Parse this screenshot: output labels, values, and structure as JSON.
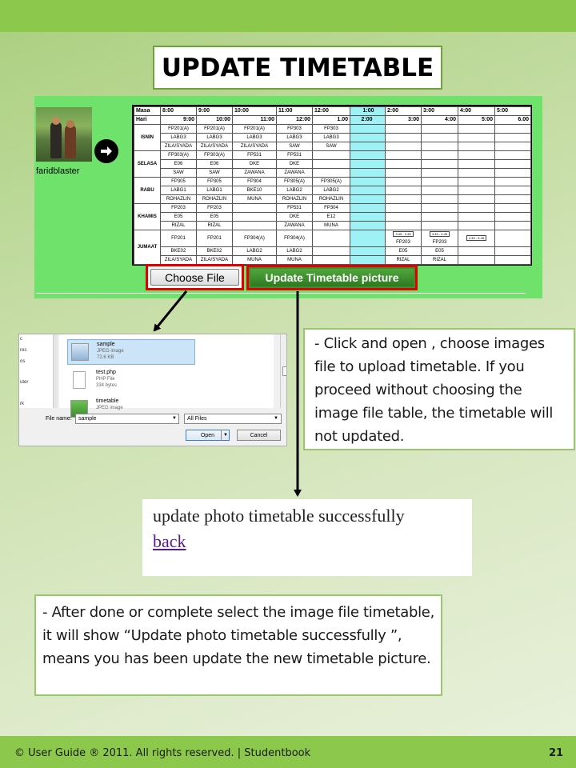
{
  "page": {
    "title": "UPDATE TIMETABLE",
    "footer": "© User Guide ® 2011. All rights reserved. | Studentbook",
    "page_number": "21"
  },
  "profile": {
    "username": "faridblaster",
    "avatar_icon": "profile-photo",
    "arrow_icon": "right-arrow-circle-icon"
  },
  "timetable": {
    "header_masa": "Masa",
    "header_hari": "Hari",
    "slots_start": [
      "8:00",
      "9:00",
      "10:00",
      "11:00",
      "12:00",
      "1:00",
      "2:00",
      "3:00",
      "4:00",
      "5:00"
    ],
    "slots_end": [
      "9:00",
      "10:00",
      "11:00",
      "12:00",
      "1.00",
      "2:00",
      "3:00",
      "4:00",
      "5:00",
      "6.00"
    ],
    "days": [
      {
        "name": "ISNIN",
        "cells": [
          [
            "FP201(A)",
            "LABG3",
            "ZILA/SYADA"
          ],
          [
            "FP201(A)",
            "LABG3",
            "ZILA/SYADA"
          ],
          [
            "FP201(A)",
            "LABG3",
            "ZILA/SYADA"
          ],
          [
            "FP303",
            "LABG3",
            "SAW"
          ],
          [
            "FP303",
            "LABG3",
            "SAW"
          ]
        ]
      },
      {
        "name": "SELASA",
        "cells": [
          [
            "FP303(A)",
            "E06",
            "SAW"
          ],
          [
            "FP303(A)",
            "E06",
            "SAW"
          ],
          [
            "FP531",
            "DKE",
            "ZAWANA"
          ],
          [
            "FP531",
            "DKE",
            "ZAWANA"
          ],
          [
            "",
            "",
            ""
          ]
        ]
      },
      {
        "name": "RABU",
        "cells": [
          [
            "FP305",
            "LABG1",
            "ROHAZLIN"
          ],
          [
            "FP305",
            "LABG1",
            "ROHAZLIN"
          ],
          [
            "FP304",
            "BKE10",
            "MUNA"
          ],
          [
            "FP305(A)",
            "LABG2",
            "ROHAZLIN"
          ],
          [
            "FP305(A)",
            "LABG2",
            "ROHAZLIN"
          ]
        ]
      },
      {
        "name": "KHAMIS",
        "cells": [
          [
            "FP203",
            "E05",
            "RIZAL"
          ],
          [
            "FP203",
            "E05",
            "RIZAL"
          ],
          [
            "",
            "",
            ""
          ],
          [
            "FP531",
            "DKE",
            "ZAWANA"
          ],
          [
            "FP304",
            "E12",
            "MUNA"
          ]
        ]
      },
      {
        "name": "JUMAAT",
        "cells": [
          [
            "FP201",
            "BKE02",
            "ZILA/SYADA"
          ],
          [
            "FP201",
            "BKE02",
            "ZILA/SYADA"
          ],
          [
            "FP304(A)",
            "LABG2",
            "MUNA"
          ],
          [
            "FP304(A)",
            "LABG2",
            "MUNA"
          ],
          [
            "",
            "",
            ""
          ]
        ],
        "afternoon": [
          [
            "3.45 - 3.45",
            "FP203",
            "E05",
            "RIZAL"
          ],
          [
            "3.45 - 4.45",
            "FP203",
            "E05",
            "RIZAL"
          ],
          [
            "4.45 - 5.45",
            "",
            "",
            ""
          ]
        ]
      }
    ]
  },
  "buttons": {
    "choose_file": "Choose File",
    "update_picture": "Update Timetable picture"
  },
  "file_dialog": {
    "sidebar_fragments": [
      "c",
      "res",
      "os",
      "uter",
      "rk"
    ],
    "files": [
      {
        "name": "sample",
        "type": "JPEG image",
        "size": "72.6 KB"
      },
      {
        "name": "test.php",
        "type": "PHP File",
        "size": "334 bytes"
      },
      {
        "name": "timetable",
        "type": "JPEG image",
        "size": ""
      }
    ],
    "file_name_label": "File name:",
    "file_name_value": "sample",
    "file_type_value": "All Files",
    "open_label": "Open",
    "cancel_label": "Cancel"
  },
  "notes": {
    "upload_instruction": "- Click and open , choose images file to upload timetable. If you proceed without choosing the image file table, the timetable will not updated.",
    "success_instruction": "- After done or complete select the image file timetable, it will show  “Update photo timetable successfully ”, means you has been update the new timetable picture."
  },
  "result": {
    "message": "update photo timetable successfully",
    "back_link": "back"
  },
  "colors": {
    "header_bar": "#8cc84b",
    "app_panel": "#6ee26a",
    "highlight_border": "#e00000",
    "update_button": "#3e8e2f",
    "break_column": "#9ef1f5"
  }
}
